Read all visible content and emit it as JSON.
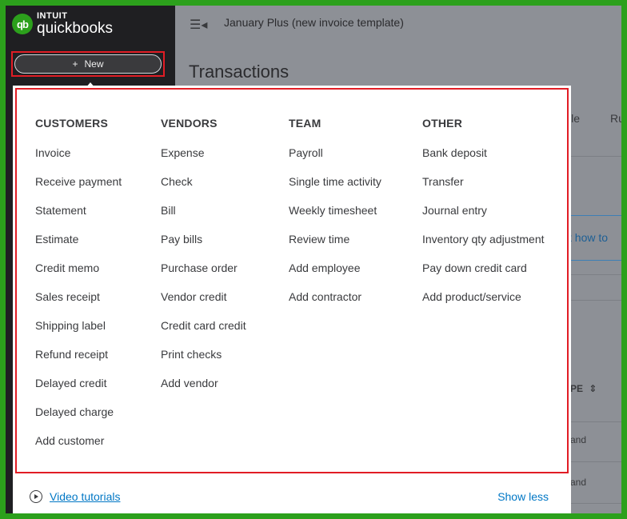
{
  "sidebar": {
    "logo_mark": "qb",
    "logo_brand": "INTUIT",
    "logo_product": "quickbooks",
    "new_button": {
      "icon": "+",
      "label": "New"
    }
  },
  "header": {
    "menu_icon": "hamburger-collapse-icon",
    "company_name": "January Plus (new invoice template)",
    "page_title": "Transactions"
  },
  "background": {
    "tab_fragment_1": "ile",
    "tab_fragment_2": "Ru",
    "link_fragment": "t how to",
    "column_fragment": "PE",
    "row_fragment_1": "and",
    "row_fragment_2": "and"
  },
  "new_menu": {
    "columns": [
      {
        "heading": "CUSTOMERS",
        "items": [
          "Invoice",
          "Receive payment",
          "Statement",
          "Estimate",
          "Credit memo",
          "Sales receipt",
          "Shipping label",
          "Refund receipt",
          "Delayed credit",
          "Delayed charge",
          "Add customer"
        ]
      },
      {
        "heading": "VENDORS",
        "items": [
          "Expense",
          "Check",
          "Bill",
          "Pay bills",
          "Purchase order",
          "Vendor credit",
          "Credit card credit",
          "Print checks",
          "Add vendor"
        ]
      },
      {
        "heading": "TEAM",
        "items": [
          "Payroll",
          "Single time activity",
          "Weekly timesheet",
          "Review time",
          "Add employee",
          "Add contractor"
        ]
      },
      {
        "heading": "OTHER",
        "items": [
          "Bank deposit",
          "Transfer",
          "Journal entry",
          "Inventory qty adjustment",
          "Pay down credit card",
          "Add product/service"
        ]
      }
    ],
    "footer": {
      "video_link": "Video tutorials",
      "show_less": "Show less"
    }
  },
  "colors": {
    "brand_green": "#2ca01c",
    "highlight_red": "#e11d25",
    "link_blue": "#0077c5",
    "sidebar_dark": "#1f1f22"
  }
}
